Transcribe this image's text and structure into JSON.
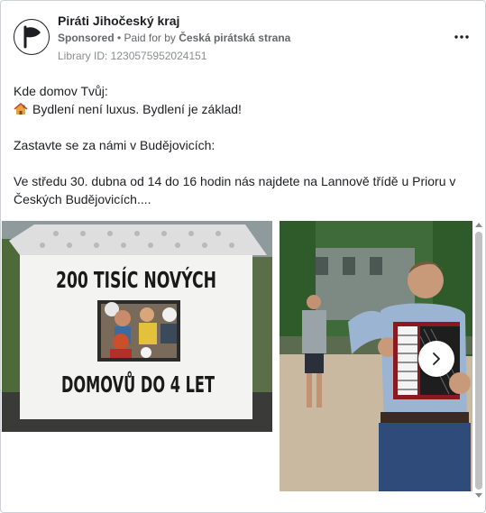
{
  "ad": {
    "page_name": "Piráti Jihočeský kraj",
    "sponsored_label": "Sponsored",
    "separator": " • ",
    "paid_for_prefix": "Paid for by ",
    "payer": "Česká pirátská strana",
    "library_id": "Library ID: 1230575952024151",
    "more_icon": "more-horizontal-icon"
  },
  "text": {
    "line1": "Kde domov Tvůj:",
    "line2": "Bydlení není luxus. Bydlení je základ!",
    "line3": "Zastavte se za námi v Budějovicích:",
    "line4": "Ve středu 30. dubna od 14 do 16 hodin nás najdete na Lannově třídě u Prioru v Českých Budějovicích...."
  },
  "slide1": {
    "sign_top": "200 TISÍC NOVÝCH",
    "sign_bottom": "DOMOVŮ DO 4 LET"
  },
  "carousel": {
    "next_icon": "chevron-right-icon"
  },
  "colors": {
    "text": "#1c1e21",
    "muted": "#65676b",
    "border": "#ccd0d5"
  }
}
